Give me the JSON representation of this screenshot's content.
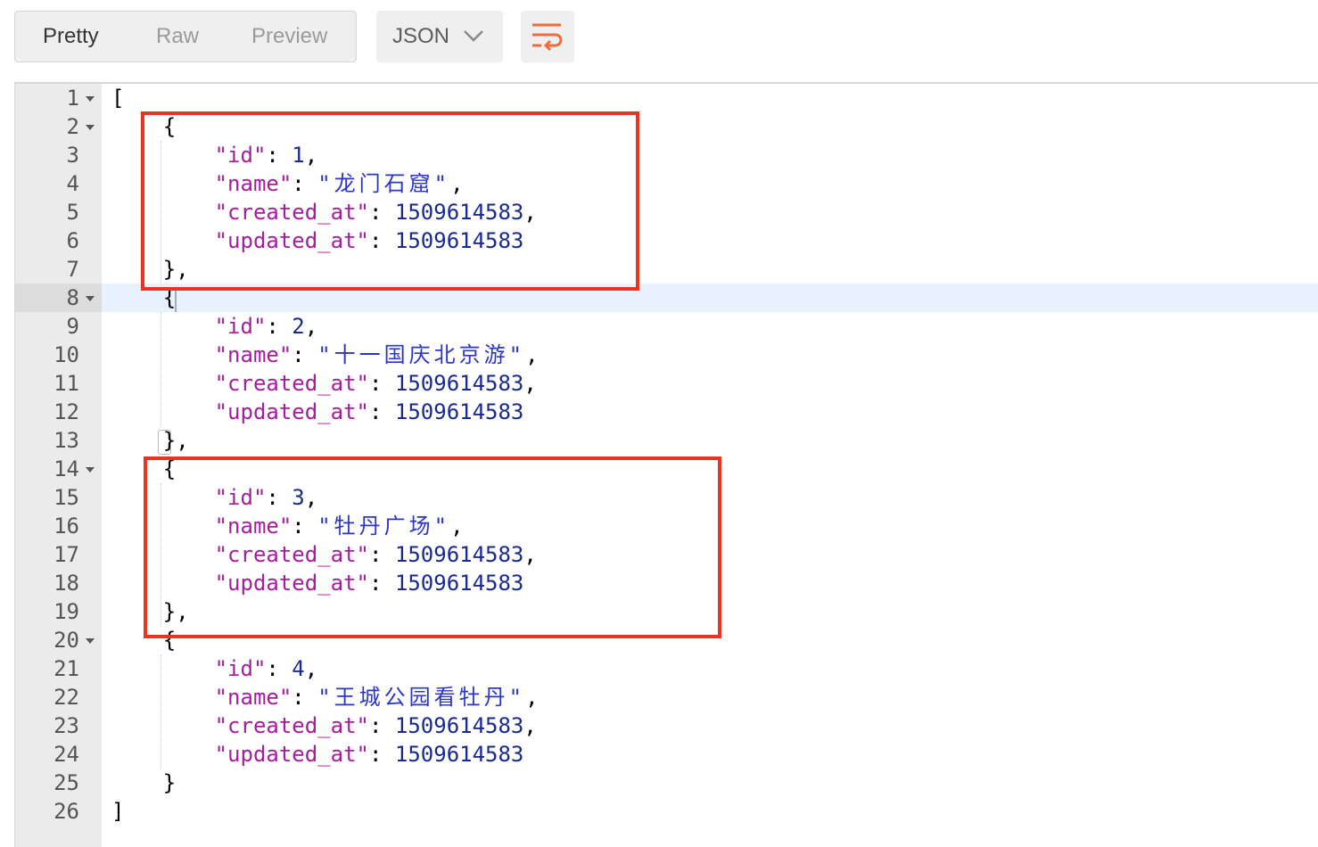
{
  "toolbar": {
    "view_tabs": [
      {
        "label": "Pretty",
        "active": true
      },
      {
        "label": "Raw",
        "active": false
      },
      {
        "label": "Preview",
        "active": false
      }
    ],
    "format_select": {
      "value": "JSON",
      "icon": "chevron-down-icon"
    },
    "wrap_button": {
      "icon": "wrap-lines-icon",
      "color": "#f26b3a"
    }
  },
  "editor": {
    "active_line": 8,
    "line_numbers": [
      "1",
      "2",
      "3",
      "4",
      "5",
      "6",
      "7",
      "8",
      "9",
      "10",
      "11",
      "12",
      "13",
      "14",
      "15",
      "16",
      "17",
      "18",
      "19",
      "20",
      "21",
      "22",
      "23",
      "24",
      "25",
      "26"
    ],
    "foldable_lines": [
      1,
      2,
      8,
      14,
      20
    ],
    "records": [
      {
        "id": "1",
        "name": "\"龙门石窟\"",
        "created_at": "1509614583",
        "updated_at": "1509614583"
      },
      {
        "id": "2",
        "name": "\"十一国庆北京游\"",
        "created_at": "1509614583",
        "updated_at": "1509614583"
      },
      {
        "id": "3",
        "name": "\"牡丹广场\"",
        "created_at": "1509614583",
        "updated_at": "1509614583"
      },
      {
        "id": "4",
        "name": "\"王城公园看牡丹\"",
        "created_at": "1509614583",
        "updated_at": "1509614583"
      }
    ],
    "keys": {
      "id": "\"id\"",
      "name": "\"name\"",
      "created_at": "\"created_at\"",
      "updated_at": "\"updated_at\""
    },
    "brackets": {
      "array_open": "[",
      "array_close": "]",
      "obj_open": "{",
      "obj_close": "}",
      "obj_close_comma": "},"
    },
    "punct": {
      "colon": ": ",
      "comma": ","
    }
  },
  "annotations": {
    "highlight_color": "#ea3323",
    "highlighted_records": [
      1,
      3
    ]
  },
  "colors": {
    "key": "#a31e9c",
    "string": "#2b36c6",
    "number": "#1a2a8c",
    "active_line_bg": "#e8f2fe",
    "gutter_bg": "#ebebeb"
  }
}
